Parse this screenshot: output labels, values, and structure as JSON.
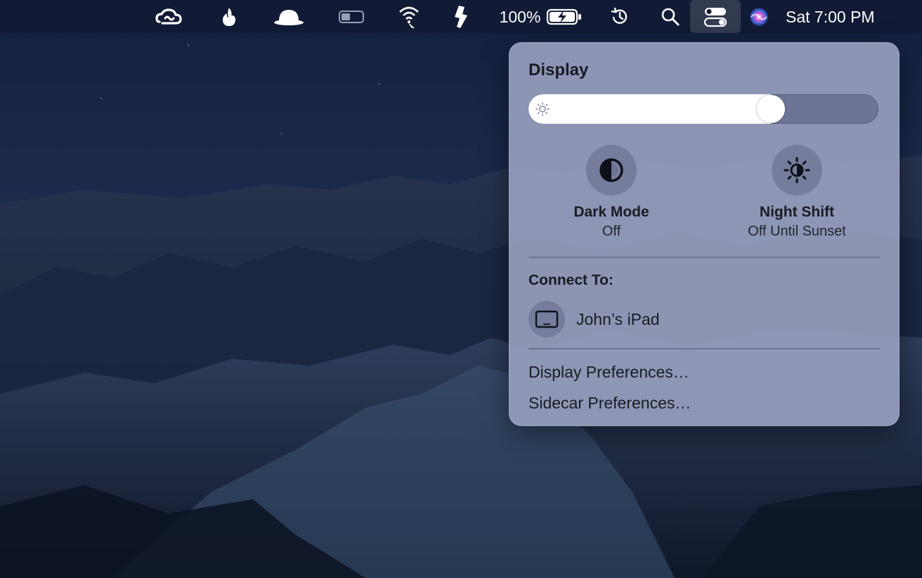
{
  "menubar": {
    "items": [
      {
        "icon": "creative-cloud-icon"
      },
      {
        "icon": "flame-icon"
      },
      {
        "icon": "bell-hat-icon"
      },
      {
        "icon": "battery-toggle-icon"
      },
      {
        "icon": "wifi-icon"
      },
      {
        "icon": "tape-icon"
      },
      {
        "icon": "time-machine-icon"
      },
      {
        "icon": "search-icon"
      },
      {
        "icon": "control-center-icon"
      },
      {
        "icon": "siri-icon"
      }
    ],
    "battery_percent": "100%",
    "battery_level": 1.0,
    "clock": "Sat 7:00 PM"
  },
  "display_panel": {
    "title": "Display",
    "brightness": 0.71,
    "toggles": [
      {
        "label": "Dark Mode",
        "status": "Off",
        "icon": "dark-mode-icon"
      },
      {
        "label": "Night Shift",
        "status": "Off Until Sunset",
        "icon": "night-shift-icon"
      }
    ],
    "connect_title": "Connect To:",
    "devices": [
      {
        "label": "John’s iPad",
        "icon": "ipad-icon"
      }
    ],
    "links": [
      "Display Preferences…",
      "Sidecar Preferences…"
    ]
  },
  "colors": {
    "menubar_bg": "#121b34",
    "panel_bg": "#969ebc",
    "accent_white": "#ffffff"
  }
}
